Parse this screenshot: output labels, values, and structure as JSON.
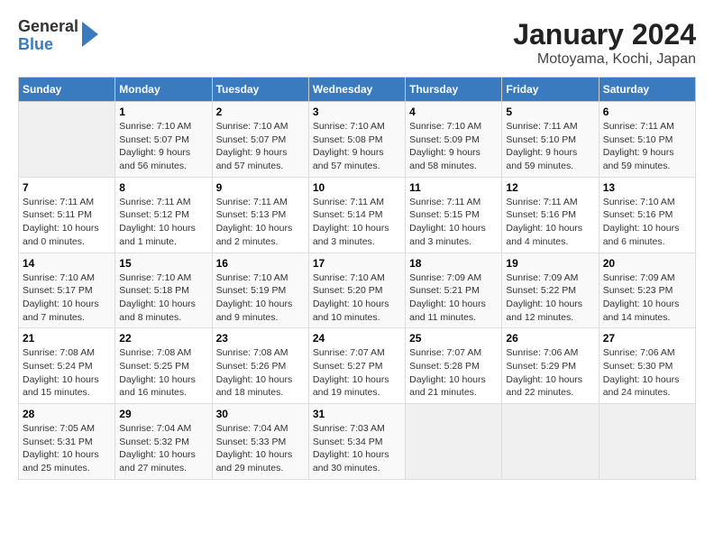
{
  "logo": {
    "general": "General",
    "blue": "Blue"
  },
  "title": "January 2024",
  "subtitle": "Motoyama, Kochi, Japan",
  "days_of_week": [
    "Sunday",
    "Monday",
    "Tuesday",
    "Wednesday",
    "Thursday",
    "Friday",
    "Saturday"
  ],
  "weeks": [
    [
      {
        "day": "",
        "info": ""
      },
      {
        "day": "1",
        "info": "Sunrise: 7:10 AM\nSunset: 5:07 PM\nDaylight: 9 hours\nand 56 minutes."
      },
      {
        "day": "2",
        "info": "Sunrise: 7:10 AM\nSunset: 5:07 PM\nDaylight: 9 hours\nand 57 minutes."
      },
      {
        "day": "3",
        "info": "Sunrise: 7:10 AM\nSunset: 5:08 PM\nDaylight: 9 hours\nand 57 minutes."
      },
      {
        "day": "4",
        "info": "Sunrise: 7:10 AM\nSunset: 5:09 PM\nDaylight: 9 hours\nand 58 minutes."
      },
      {
        "day": "5",
        "info": "Sunrise: 7:11 AM\nSunset: 5:10 PM\nDaylight: 9 hours\nand 59 minutes."
      },
      {
        "day": "6",
        "info": "Sunrise: 7:11 AM\nSunset: 5:10 PM\nDaylight: 9 hours\nand 59 minutes."
      }
    ],
    [
      {
        "day": "7",
        "info": "Sunrise: 7:11 AM\nSunset: 5:11 PM\nDaylight: 10 hours\nand 0 minutes."
      },
      {
        "day": "8",
        "info": "Sunrise: 7:11 AM\nSunset: 5:12 PM\nDaylight: 10 hours\nand 1 minute."
      },
      {
        "day": "9",
        "info": "Sunrise: 7:11 AM\nSunset: 5:13 PM\nDaylight: 10 hours\nand 2 minutes."
      },
      {
        "day": "10",
        "info": "Sunrise: 7:11 AM\nSunset: 5:14 PM\nDaylight: 10 hours\nand 3 minutes."
      },
      {
        "day": "11",
        "info": "Sunrise: 7:11 AM\nSunset: 5:15 PM\nDaylight: 10 hours\nand 3 minutes."
      },
      {
        "day": "12",
        "info": "Sunrise: 7:11 AM\nSunset: 5:16 PM\nDaylight: 10 hours\nand 4 minutes."
      },
      {
        "day": "13",
        "info": "Sunrise: 7:10 AM\nSunset: 5:16 PM\nDaylight: 10 hours\nand 6 minutes."
      }
    ],
    [
      {
        "day": "14",
        "info": "Sunrise: 7:10 AM\nSunset: 5:17 PM\nDaylight: 10 hours\nand 7 minutes."
      },
      {
        "day": "15",
        "info": "Sunrise: 7:10 AM\nSunset: 5:18 PM\nDaylight: 10 hours\nand 8 minutes."
      },
      {
        "day": "16",
        "info": "Sunrise: 7:10 AM\nSunset: 5:19 PM\nDaylight: 10 hours\nand 9 minutes."
      },
      {
        "day": "17",
        "info": "Sunrise: 7:10 AM\nSunset: 5:20 PM\nDaylight: 10 hours\nand 10 minutes."
      },
      {
        "day": "18",
        "info": "Sunrise: 7:09 AM\nSunset: 5:21 PM\nDaylight: 10 hours\nand 11 minutes."
      },
      {
        "day": "19",
        "info": "Sunrise: 7:09 AM\nSunset: 5:22 PM\nDaylight: 10 hours\nand 12 minutes."
      },
      {
        "day": "20",
        "info": "Sunrise: 7:09 AM\nSunset: 5:23 PM\nDaylight: 10 hours\nand 14 minutes."
      }
    ],
    [
      {
        "day": "21",
        "info": "Sunrise: 7:08 AM\nSunset: 5:24 PM\nDaylight: 10 hours\nand 15 minutes."
      },
      {
        "day": "22",
        "info": "Sunrise: 7:08 AM\nSunset: 5:25 PM\nDaylight: 10 hours\nand 16 minutes."
      },
      {
        "day": "23",
        "info": "Sunrise: 7:08 AM\nSunset: 5:26 PM\nDaylight: 10 hours\nand 18 minutes."
      },
      {
        "day": "24",
        "info": "Sunrise: 7:07 AM\nSunset: 5:27 PM\nDaylight: 10 hours\nand 19 minutes."
      },
      {
        "day": "25",
        "info": "Sunrise: 7:07 AM\nSunset: 5:28 PM\nDaylight: 10 hours\nand 21 minutes."
      },
      {
        "day": "26",
        "info": "Sunrise: 7:06 AM\nSunset: 5:29 PM\nDaylight: 10 hours\nand 22 minutes."
      },
      {
        "day": "27",
        "info": "Sunrise: 7:06 AM\nSunset: 5:30 PM\nDaylight: 10 hours\nand 24 minutes."
      }
    ],
    [
      {
        "day": "28",
        "info": "Sunrise: 7:05 AM\nSunset: 5:31 PM\nDaylight: 10 hours\nand 25 minutes."
      },
      {
        "day": "29",
        "info": "Sunrise: 7:04 AM\nSunset: 5:32 PM\nDaylight: 10 hours\nand 27 minutes."
      },
      {
        "day": "30",
        "info": "Sunrise: 7:04 AM\nSunset: 5:33 PM\nDaylight: 10 hours\nand 29 minutes."
      },
      {
        "day": "31",
        "info": "Sunrise: 7:03 AM\nSunset: 5:34 PM\nDaylight: 10 hours\nand 30 minutes."
      },
      {
        "day": "",
        "info": ""
      },
      {
        "day": "",
        "info": ""
      },
      {
        "day": "",
        "info": ""
      }
    ]
  ]
}
